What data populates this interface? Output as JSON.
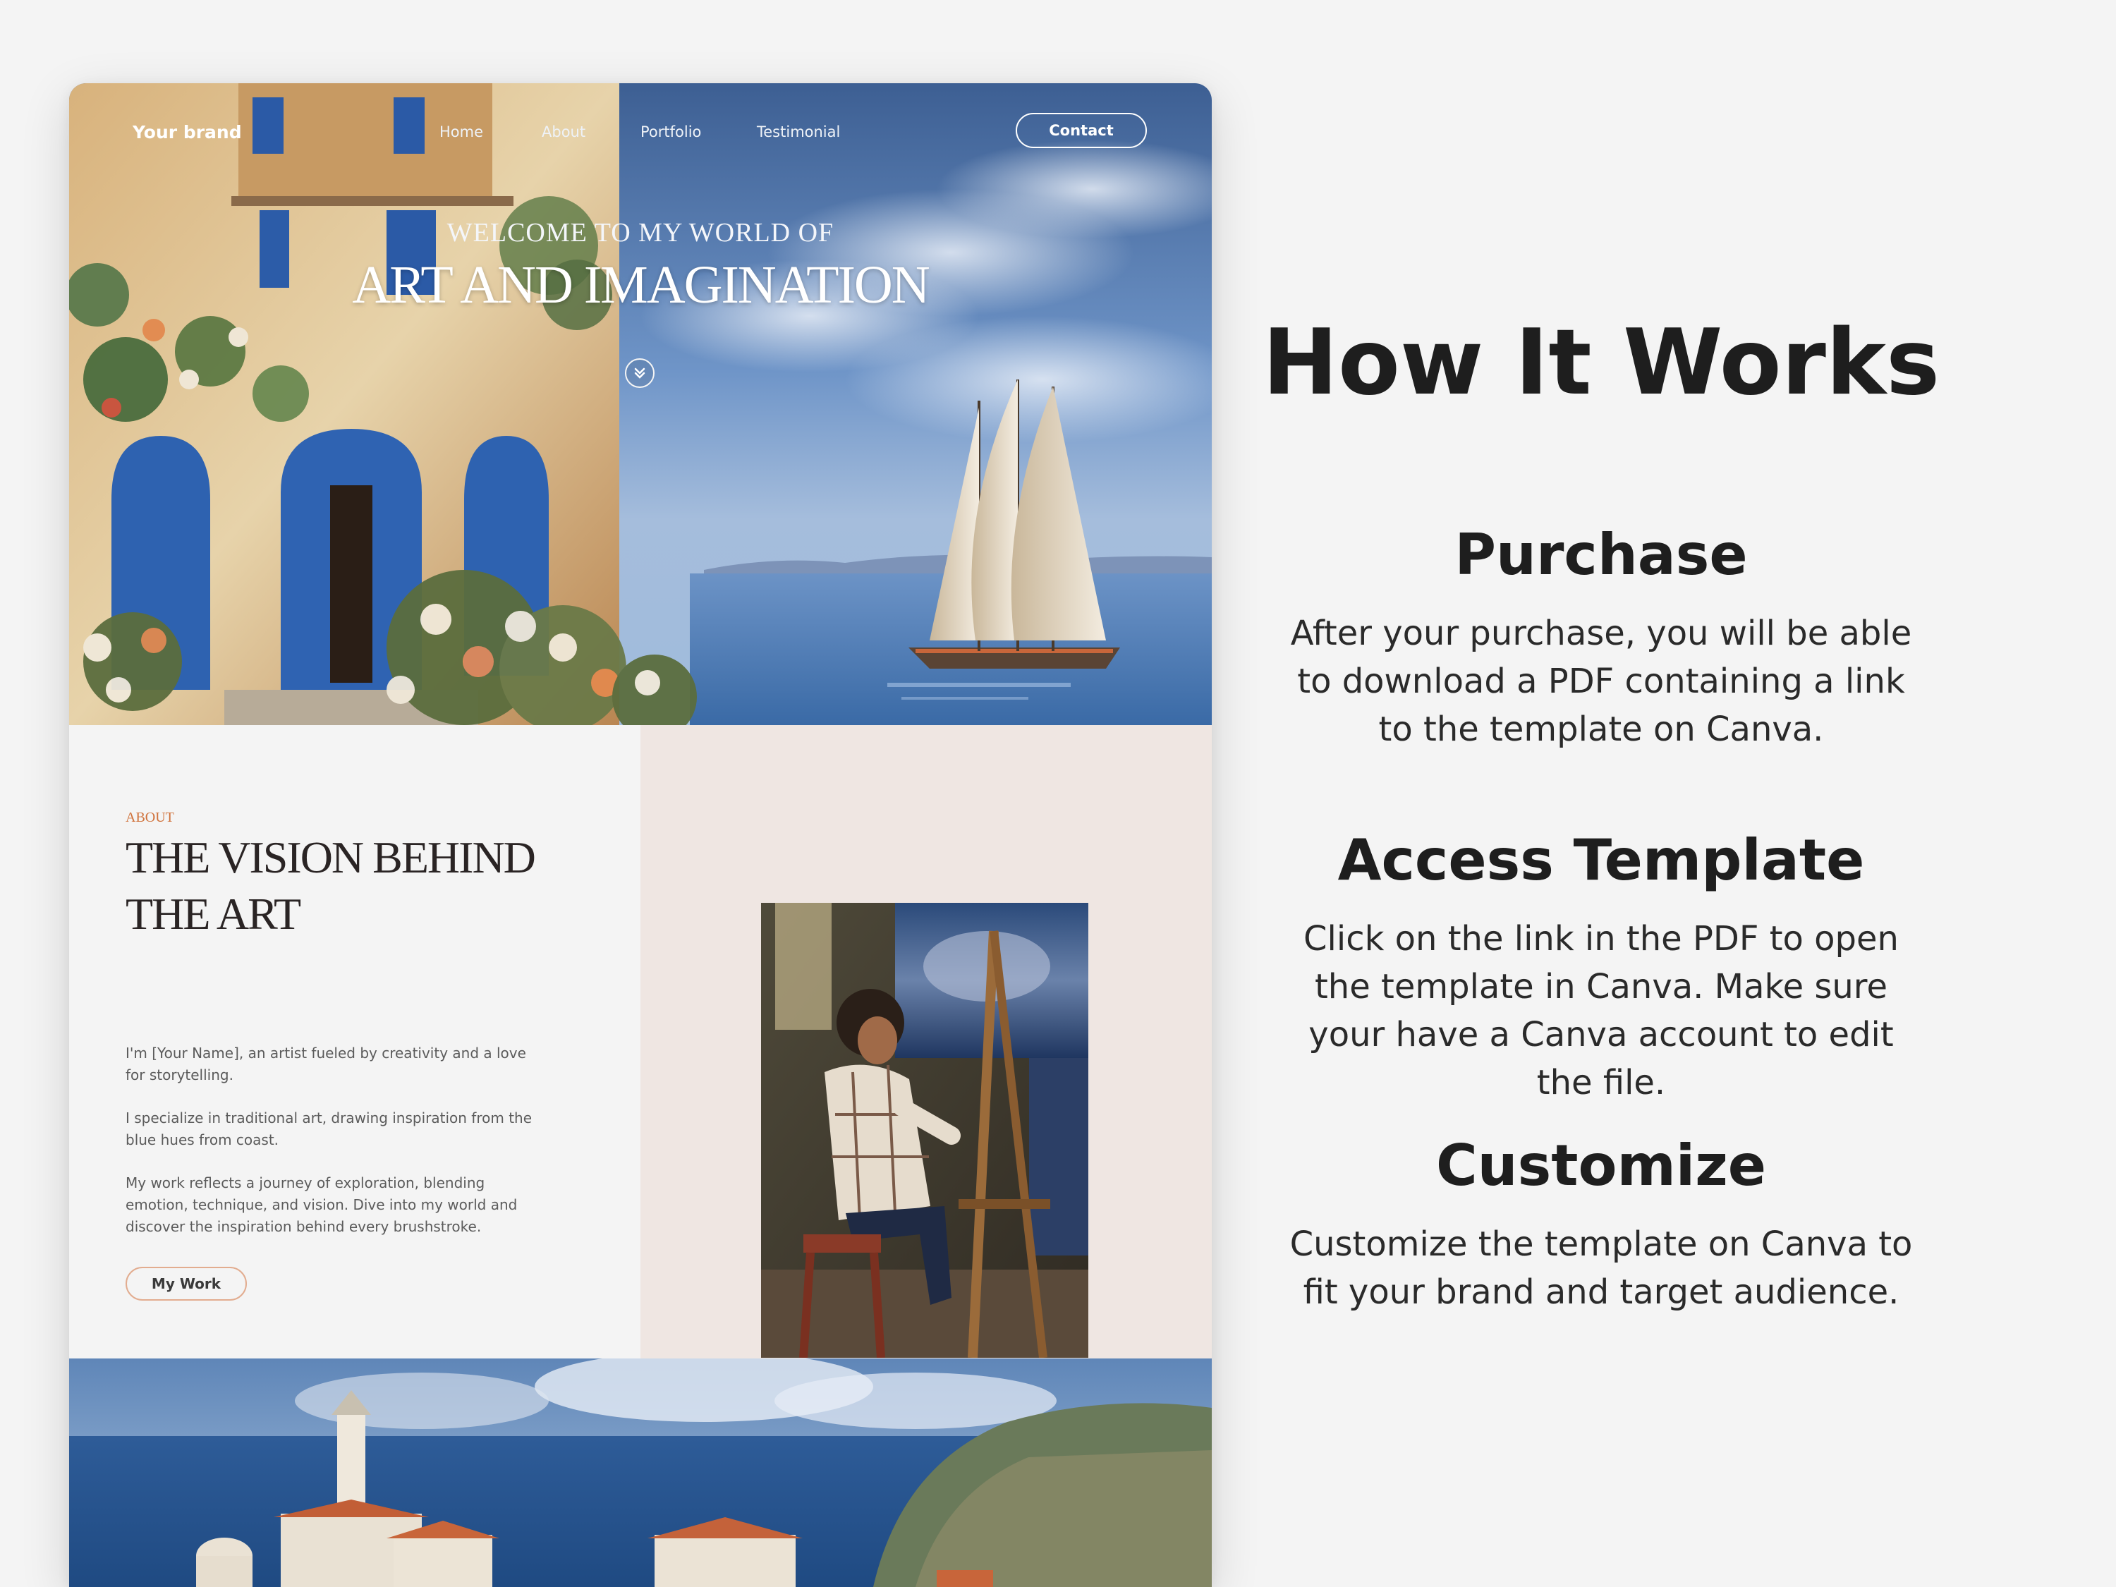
{
  "nav": {
    "brand": "Your brand",
    "links": [
      "Home",
      "About",
      "Portfolio",
      "Testimonial"
    ],
    "contact": "Contact"
  },
  "hero": {
    "kicker": "WELCOME TO MY WORLD OF",
    "title": "ART AND IMAGINATION",
    "scroll_icon": "chevron-double-down-icon"
  },
  "about": {
    "kicker": "ABOUT",
    "title": "THE VISION BEHIND THE ART",
    "paragraphs": [
      "I'm [Your Name], an artist fueled by creativity and a love for storytelling.",
      "I specialize in traditional art, drawing inspiration from the blue hues from coast.",
      "My work reflects a journey of exploration, blending emotion, technique, and vision. Dive into my world and discover the inspiration behind every brushstroke."
    ],
    "button": "My Work"
  },
  "how": {
    "title": "How It Works",
    "steps": [
      {
        "title": "Purchase",
        "text": "After your purchase, you will be able to download a PDF containing a link to the template on Canva."
      },
      {
        "title": "Access Template",
        "text": "Click on the link in the PDF to open the template in Canva. Make sure your have a Canva account to edit the file."
      },
      {
        "title": "Customize",
        "text": "Customize the template on Canva to fit your brand and target audience."
      }
    ]
  },
  "colors": {
    "page_bg": "#f4f4f4",
    "about_right_bg": "#efe6e2",
    "accent": "#d0723b",
    "button_border": "#e2ac8f",
    "heading": "#1e1e1e"
  }
}
